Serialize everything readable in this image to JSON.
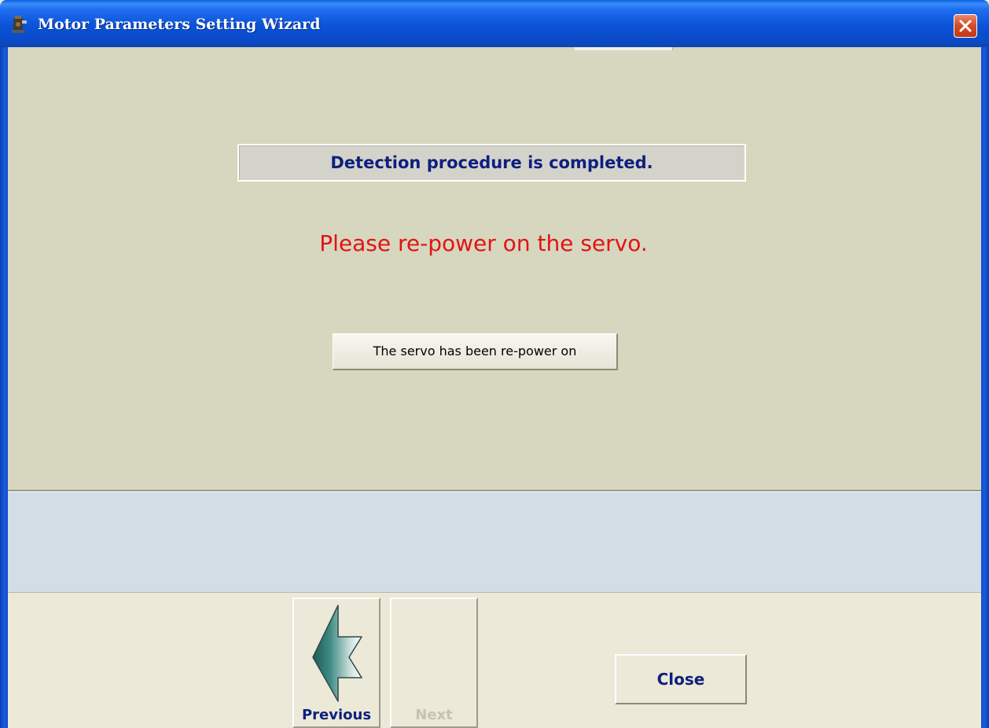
{
  "window": {
    "title": "Motor Parameters Setting Wizard"
  },
  "status": {
    "message": "Detection procedure is completed."
  },
  "instruction": {
    "text": "Please re-power on the servo."
  },
  "action": {
    "button_label": "The servo has been re-power on"
  },
  "navigation": {
    "previous_label": "Previous",
    "next_label": "Next",
    "next_enabled": false
  },
  "footer": {
    "close_label": "Close"
  },
  "colors": {
    "titlebar": "#0b52d6",
    "content_bg": "#d7d6bf",
    "message_panel_bg": "#d2dde6",
    "instruction_text": "#e01414",
    "label_text": "#0e1f7e"
  },
  "icons": {
    "app_icon": "motor-icon",
    "close_icon": "close-x-icon",
    "previous_icon": "left-arrow-icon"
  }
}
